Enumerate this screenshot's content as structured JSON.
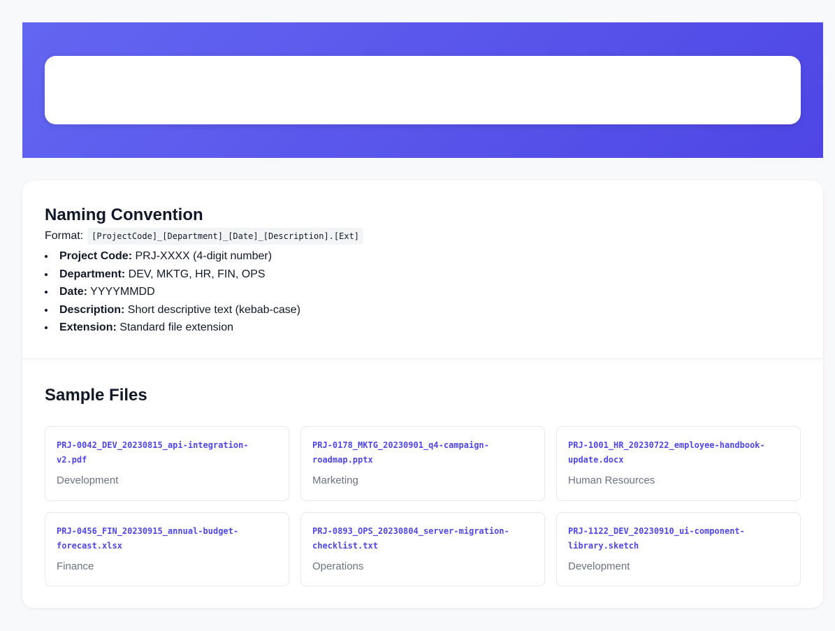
{
  "search": {
    "placeholder": ""
  },
  "naming": {
    "title": "Naming Convention",
    "format_label": "Format:",
    "format_code": "[ProjectCode]_[Department]_[Date]_[Description].[Ext]",
    "rules": [
      {
        "label": "Project Code:",
        "text": " PRJ-XXXX (4-digit number)"
      },
      {
        "label": "Department:",
        "text": " DEV, MKTG, HR, FIN, OPS"
      },
      {
        "label": "Date:",
        "text": " YYYYMMDD"
      },
      {
        "label": "Description:",
        "text": " Short descriptive text (kebab-case)"
      },
      {
        "label": "Extension:",
        "text": " Standard file extension"
      }
    ]
  },
  "samples": {
    "title": "Sample Files",
    "files": [
      {
        "name": "PRJ-0042_DEV_20230815_api-integration-v2.pdf",
        "department": "Development"
      },
      {
        "name": "PRJ-0178_MKTG_20230901_q4-campaign-roadmap.pptx",
        "department": "Marketing"
      },
      {
        "name": "PRJ-1001_HR_20230722_employee-handbook-update.docx",
        "department": "Human Resources"
      },
      {
        "name": "PRJ-0456_FIN_20230915_annual-budget-forecast.xlsx",
        "department": "Finance"
      },
      {
        "name": "PRJ-0893_OPS_20230804_server-migration-checklist.txt",
        "department": "Operations"
      },
      {
        "name": "PRJ-1122_DEV_20230910_ui-component-library.sketch",
        "department": "Development"
      }
    ]
  },
  "colors": {
    "accent": "#4f46e5",
    "hero_start": "#6366f1",
    "hero_end": "#4f46e5",
    "muted_text": "#6b7280"
  }
}
